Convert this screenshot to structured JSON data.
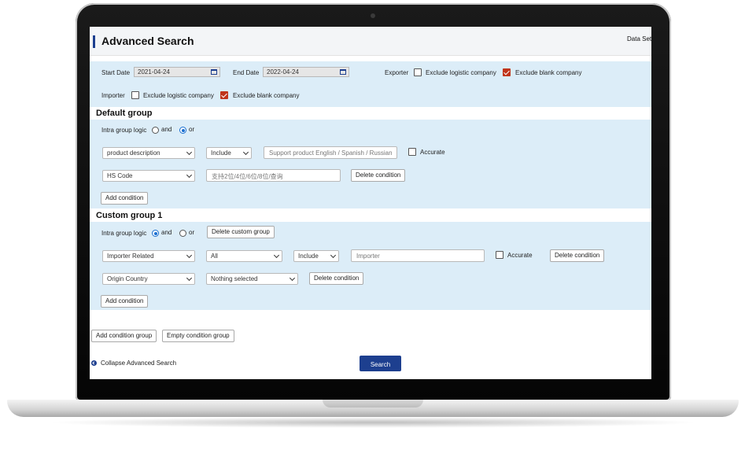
{
  "page": {
    "title": "Advanced Search",
    "dataset_label": "Data Sets"
  },
  "filters": {
    "start_date_label": "Start Date",
    "start_date_value": "2021-04-24",
    "end_date_label": "End Date",
    "end_date_value": "2022-04-24",
    "exporter_label": "Exporter",
    "exporter_exclude_logistic": {
      "label": "Exclude logistic company",
      "checked": false
    },
    "exporter_exclude_blank": {
      "label": "Exclude blank company",
      "checked": true
    },
    "importer_label": "Importer",
    "importer_exclude_logistic": {
      "label": "Exclude logistic company",
      "checked": false
    },
    "importer_exclude_blank": {
      "label": "Exclude blank company",
      "checked": true
    }
  },
  "default_group": {
    "title": "Default group",
    "logic_label": "Intra group logic",
    "logic_and": "and",
    "logic_or": "or",
    "logic_selected": "or",
    "row1": {
      "field": "product description",
      "operator": "Include",
      "value_placeholder": "Support product English / Spanish / Russian",
      "accurate_label": "Accurate"
    },
    "row2": {
      "field": "HS Code",
      "value_placeholder": "支持2位/4位/6位/8位/查询",
      "delete_label": "Delete condition"
    },
    "add_condition_label": "Add condition"
  },
  "custom_group": {
    "title": "Custom group 1",
    "logic_label": "Intra group logic",
    "logic_and": "and",
    "logic_or": "or",
    "logic_selected": "and",
    "delete_group_label": "Delete custom group",
    "row1": {
      "field": "Importer Related",
      "scope": "All",
      "operator": "Include",
      "value_placeholder": "Importer",
      "accurate_label": "Accurate",
      "delete_label": "Delete condition"
    },
    "row2": {
      "field": "Origin Country",
      "value": "Nothing selected",
      "delete_label": "Delete condition"
    },
    "add_condition_label": "Add condition"
  },
  "footer": {
    "add_group_label": "Add condition group",
    "empty_group_label": "Empty condition group",
    "collapse_label": "Collapse Advanced Search",
    "search_label": "Search"
  },
  "colors": {
    "accent": "#1d3f8f",
    "band": "#dcedf8",
    "checked": "#c0351b",
    "radio": "#1a6fd0"
  }
}
